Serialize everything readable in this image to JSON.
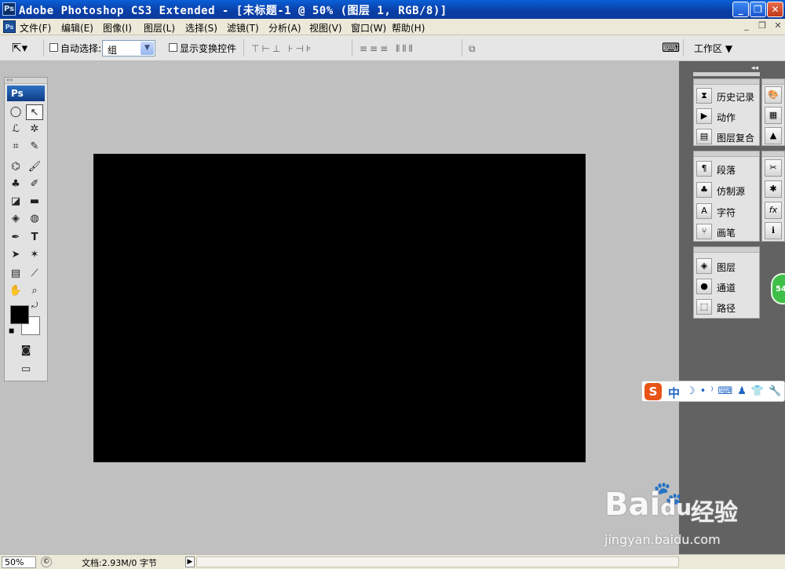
{
  "window": {
    "app_icon": "Ps",
    "title": "Adobe Photoshop CS3 Extended - [未标题-1 @ 50% (图层 1, RGB/8)]",
    "buttons": {
      "minimize": "_",
      "restore": "❐",
      "close": "✕"
    }
  },
  "menubar": {
    "doc_icon": "Ps",
    "items": [
      "文件(F)",
      "编辑(E)",
      "图像(I)",
      "图层(L)",
      "选择(S)",
      "滤镜(T)",
      "分析(A)",
      "视图(V)",
      "窗口(W)",
      "帮助(H)"
    ],
    "mdi_buttons": [
      "_",
      "❐",
      "✕"
    ]
  },
  "options": {
    "auto_select_label": "自动选择:",
    "auto_select_value": "组",
    "show_transform_label": "显示变换控件",
    "workspace_label": "工作区"
  },
  "tools": {
    "logo": "Ps",
    "header": "««"
  },
  "panels": {
    "group1": [
      "历史记录",
      "动作",
      "图层复合"
    ],
    "group2": [
      "段落",
      "仿制源",
      "字符",
      "画笔"
    ],
    "group3": [
      "图层",
      "通道",
      "路径"
    ],
    "collapse": "◂◂"
  },
  "status": {
    "zoom": "50%",
    "doc_info": "文档:2.93M/0 字节"
  },
  "ime": {
    "logo": "S",
    "mode": "中"
  },
  "badge": {
    "text": "54"
  },
  "watermark": {
    "brand": "Bai",
    "brand2": "du",
    "cn": "经验",
    "url": "jingyan.baidu.com"
  },
  "colors": {
    "canvas": "#000000",
    "foreground": "#000000",
    "background": "#ffffff"
  }
}
